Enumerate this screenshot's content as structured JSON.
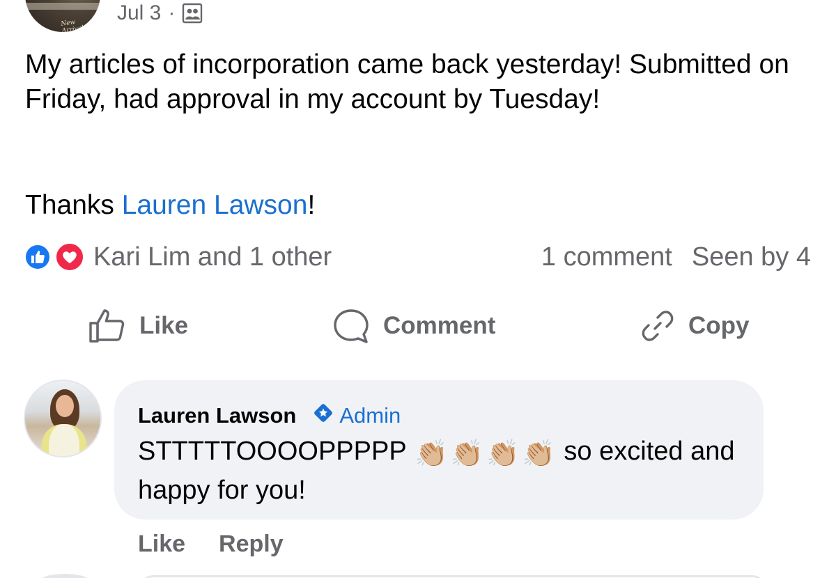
{
  "post": {
    "date": "Jul 3",
    "separator": "·",
    "audience_icon": "group-audience-icon",
    "text": "My articles of incorporation came back yesterday! Submitted on Friday, had approval in my account by Tuesday!",
    "thanks_prefix": "Thanks ",
    "thanks_mention": "Lauren Lawson",
    "thanks_suffix": "!"
  },
  "stats": {
    "reactions": [
      "like",
      "love"
    ],
    "reaction_names": "Kari Lim and 1 other",
    "comments": "1 comment",
    "seen_by": "Seen by 4"
  },
  "actions": {
    "like": "Like",
    "comment": "Comment",
    "copy": "Copy"
  },
  "comment": {
    "author": "Lauren Lawson",
    "badge": "Admin",
    "text_before": "STTTTTOOOOPPPPP ",
    "emoji": [
      "👏🏼",
      "👏🏼",
      "👏🏼",
      "👏🏼"
    ],
    "text_after": " so excited and happy for you!",
    "actions": {
      "like": "Like",
      "reply": "Reply"
    }
  },
  "colors": {
    "accent": "#1877f2",
    "mention": "#1b6fd1",
    "love": "#f02849",
    "secondary_text": "#65676b",
    "bubble": "#f0f2f5"
  }
}
